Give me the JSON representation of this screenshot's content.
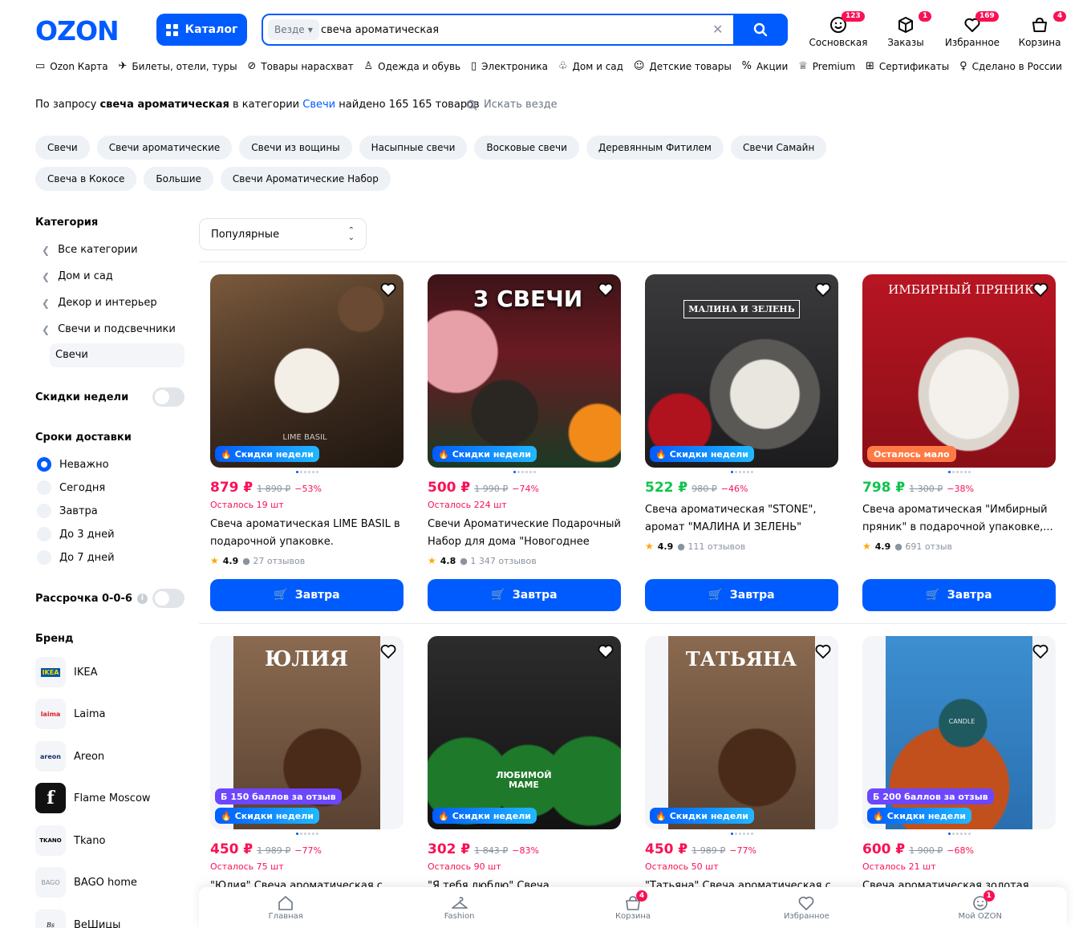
{
  "header": {
    "logo": "OZON",
    "catalog_label": "Каталог",
    "search_scope": "Везде",
    "search_value": "свеча ароматическая",
    "items": [
      {
        "label": "Сосновская",
        "badge": "123",
        "icon": "face-icon"
      },
      {
        "label": "Заказы",
        "badge": "1",
        "icon": "box-icon"
      },
      {
        "label": "Избранное",
        "badge": "169",
        "icon": "heart-icon"
      },
      {
        "label": "Корзина",
        "badge": "4",
        "icon": "cart-icon"
      }
    ]
  },
  "nav": [
    {
      "label": "Ozon Карта",
      "icon": "card-icon"
    },
    {
      "label": "Билеты, отели, туры",
      "icon": "plane-icon"
    },
    {
      "label": "Товары нарасхват",
      "icon": "percent-icon"
    },
    {
      "label": "Одежда и обувь",
      "icon": "hanger-icon"
    },
    {
      "label": "Электроника",
      "icon": "phone-icon"
    },
    {
      "label": "Дом и сад",
      "icon": "plant-icon"
    },
    {
      "label": "Детские товары",
      "icon": "baby-icon"
    },
    {
      "label": "Акции",
      "icon": "discount-icon"
    },
    {
      "label": "Premium",
      "icon": "crown-icon"
    },
    {
      "label": "Сертификаты",
      "icon": "gift-icon"
    },
    {
      "label": "Сделано в России",
      "icon": "doll-icon"
    }
  ],
  "query": {
    "prefix": "По запросу",
    "term": "свеча ароматическая",
    "mid": "в категории",
    "category": "Свечи",
    "suffix": "найдено 165 165 товаров",
    "search_all": "Искать везде"
  },
  "chips": [
    "Свечи",
    "Свечи ароматические",
    "Свечи из вощины",
    "Насыпные свечи",
    "Восковые свечи",
    "Деревянным Фитилем",
    "Свечи Самайн",
    "Свеча в Кокосе",
    "Большие",
    "Свечи Ароматические Набор"
  ],
  "sidebar": {
    "category_title": "Категория",
    "categories": [
      "Все категории",
      "Дом и сад",
      "Декор и интерьер",
      "Свечи и подсвечники"
    ],
    "active_category": "Свечи",
    "weekly_discounts": "Скидки недели",
    "delivery_title": "Сроки доставки",
    "delivery": [
      "Неважно",
      "Сегодня",
      "Завтра",
      "До 3 дней",
      "До 7 дней"
    ],
    "selected_delivery": "Неважно",
    "installment": "Рассрочка 0-0-6",
    "brand_title": "Бренд",
    "brands": [
      {
        "name": "IKEA",
        "logo": "IKEA"
      },
      {
        "name": "Laima",
        "logo": "laima"
      },
      {
        "name": "Areon",
        "logo": "areon"
      },
      {
        "name": "Flame Moscow",
        "logo": "f"
      },
      {
        "name": "Tkano",
        "logo": "TKANO"
      },
      {
        "name": "BAGO home",
        "logo": "BAGO"
      },
      {
        "name": "BeШицы",
        "logo": "Bs"
      }
    ]
  },
  "sort": {
    "label": "Популярные"
  },
  "products": [
    {
      "price": "879 ₽",
      "old": "1 890 ₽",
      "pct": "−53%",
      "stock": "Осталось 19 шт",
      "title": "Свеча ароматическая LIME BASIL в подарочной упаковке.",
      "rating": "4.9",
      "reviews": "27 отзывов",
      "tag": "Скидки недели",
      "buy": "Завтра",
      "price_color": "#f91155",
      "image_caption": "LIME BASIL"
    },
    {
      "price": "500 ₽",
      "old": "1 990 ₽",
      "pct": "−74%",
      "stock": "Осталось 224 шт",
      "title": "Свечи Ароматические Подарочный Набор для дома \"Новогоднее Чуд...",
      "rating": "4.8",
      "reviews": "1 347 отзывов",
      "tag": "Скидки недели",
      "buy": "Завтра",
      "price_color": "#f91155",
      "image_caption": "3 СВЕЧИ"
    },
    {
      "price": "522 ₽",
      "old": "980 ₽",
      "pct": "−46%",
      "stock": "",
      "title": "Свеча ароматическая \"STONE\", аромат \"МАЛИНА И ЗЕЛЕНЬ\"",
      "rating": "4.9",
      "reviews": "111 отзывов",
      "tag": "Скидки недели",
      "buy": "Завтра",
      "price_color": "#10c44c",
      "image_caption": "МАЛИНА И ЗЕЛЕНЬ"
    },
    {
      "price": "798 ₽",
      "old": "1 300 ₽",
      "pct": "−38%",
      "stock": "",
      "title": "Свеча ароматическая \"Имбирный пряник\" в подарочной упаковке,...",
      "rating": "4.9",
      "reviews": "691 отзыв",
      "tag": "Осталось мало",
      "buy": "Завтра",
      "price_color": "#10c44c",
      "image_caption": "ИМБИРНЫЙ ПРЯНИК"
    },
    {
      "price": "450 ₽",
      "old": "1 989 ₽",
      "pct": "−77%",
      "stock": "Осталось 75 шт",
      "title": "\"Юлия\" Свеча ароматическая с",
      "bonus": "150 баллов за отзыв",
      "tag": "Скидки недели",
      "price_color": "#f91155",
      "image_caption": "ЮЛИЯ"
    },
    {
      "price": "302 ₽",
      "old": "1 843 ₽",
      "pct": "−83%",
      "stock": "Осталось 90 шт",
      "title": "\"Я тебя люблю\" Свеча",
      "tag": "Скидки недели",
      "price_color": "#f91155",
      "image_caption": "ЛЮБИМОЙ МАМЕ"
    },
    {
      "price": "450 ₽",
      "old": "1 989 ₽",
      "pct": "−77%",
      "stock": "Осталось 50 шт",
      "title": "\"Татьяна\" Свеча ароматическая с",
      "tag": "Скидки недели",
      "price_color": "#f91155",
      "image_caption": "ТАТЬЯНА"
    },
    {
      "price": "600 ₽",
      "old": "1 900 ₽",
      "pct": "−68%",
      "stock": "Осталось 21 шт",
      "title": "Свеча ароматическая золотая",
      "bonus": "200 баллов за отзыв",
      "tag": "Скидки недели",
      "price_color": "#f91155",
      "image_caption": "CANDLE"
    }
  ],
  "bottombar": [
    {
      "label": "Главная",
      "icon": "home-icon"
    },
    {
      "label": "Fashion",
      "icon": "hanger-icon"
    },
    {
      "label": "Корзина",
      "icon": "cart-icon",
      "badge": "4"
    },
    {
      "label": "Избранное",
      "icon": "heart-icon"
    },
    {
      "label": "Мой OZON",
      "icon": "face-icon",
      "badge": "1"
    }
  ]
}
